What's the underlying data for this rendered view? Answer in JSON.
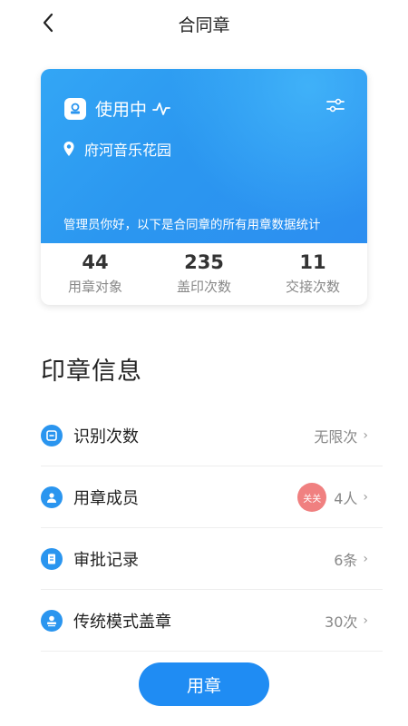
{
  "header": {
    "title": "合同章"
  },
  "card": {
    "status": "使用中",
    "location": "府河音乐花园",
    "greeting": "管理员你好，以下是合同章的所有用章数据统计",
    "stats": [
      {
        "value": "44",
        "label": "用章对象"
      },
      {
        "value": "235",
        "label": "盖印次数"
      },
      {
        "value": "11",
        "label": "交接次数"
      }
    ]
  },
  "section": {
    "title": "印章信息"
  },
  "items": [
    {
      "label": "识别次数",
      "value": "无限次",
      "icon": "scan-icon"
    },
    {
      "label": "用章成员",
      "value": "4人",
      "avatar": "关关",
      "icon": "member-icon"
    },
    {
      "label": "审批记录",
      "value": "6条",
      "icon": "record-icon"
    },
    {
      "label": "传统模式盖章",
      "value": "30次",
      "icon": "stamp-icon"
    }
  ],
  "button": {
    "label": "用章"
  },
  "colors": {
    "accent": "#2a95ef",
    "avatar": "#f08080"
  }
}
